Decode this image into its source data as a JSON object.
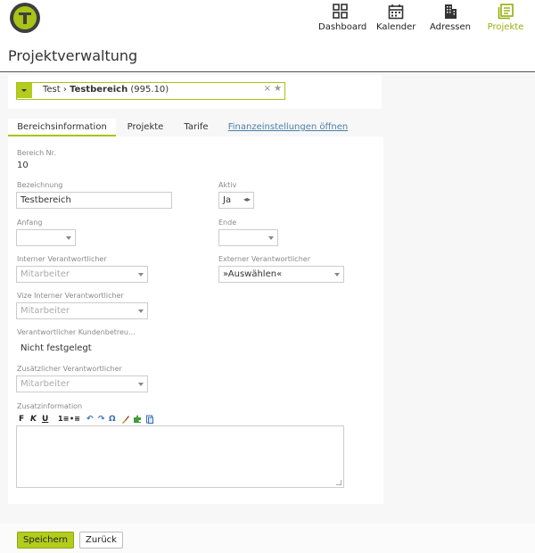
{
  "nav": {
    "items": [
      {
        "label": "Dashboard",
        "icon": "dashboard-icon",
        "active": false
      },
      {
        "label": "Kalender",
        "icon": "calendar-icon",
        "active": false
      },
      {
        "label": "Adressen",
        "icon": "building-icon",
        "active": false
      },
      {
        "label": "Projekte",
        "icon": "projects-icon",
        "active": true
      }
    ],
    "accent_color": "#a9c316"
  },
  "page": {
    "title": "Projektverwaltung"
  },
  "selector": {
    "parent": "Test",
    "separator": "›",
    "current": "Testbereich",
    "number": "(995.10)",
    "clear": "×",
    "star": "★"
  },
  "tabs": [
    {
      "label": "Bereichsinformation",
      "active": true
    },
    {
      "label": "Projekte",
      "active": false
    },
    {
      "label": "Tarife",
      "active": false
    },
    {
      "label": "Finanzeinstellungen öffnen",
      "link": true
    }
  ],
  "form": {
    "bereich_nr": {
      "label": "Bereich Nr.",
      "value": "10"
    },
    "bezeichnung": {
      "label": "Bezeichnung",
      "value": "Testbereich"
    },
    "aktiv": {
      "label": "Aktiv",
      "value": "Ja"
    },
    "anfang": {
      "label": "Anfang",
      "value": ""
    },
    "ende": {
      "label": "Ende",
      "value": ""
    },
    "interner": {
      "label": "Interner Verantwortlicher",
      "placeholder": "Mitarbeiter"
    },
    "externer": {
      "label": "Externer Verantwortlicher",
      "value": "»Auswählen«"
    },
    "vize": {
      "label": "Vize Interner Verantwortlicher",
      "placeholder": "Mitarbeiter"
    },
    "kundenbetreuer": {
      "label": "Verantwortlicher Kundenbetreu...",
      "value": "Nicht festgelegt"
    },
    "zusaetzlicher": {
      "label": "Zusätzlicher Verantwortlicher",
      "placeholder": "Mitarbeiter"
    },
    "zusatzinformation": {
      "label": "Zusatzinformation",
      "value": ""
    }
  },
  "editor_toolbar": {
    "bold": "F",
    "italic": "K",
    "underline": "U",
    "ordered_list": "1≡",
    "bullet_list": "•≡",
    "undo": "↶",
    "redo": "↷",
    "special_char": "Ω"
  },
  "footer": {
    "save_label": "Speichern",
    "back_label": "Zurück"
  }
}
